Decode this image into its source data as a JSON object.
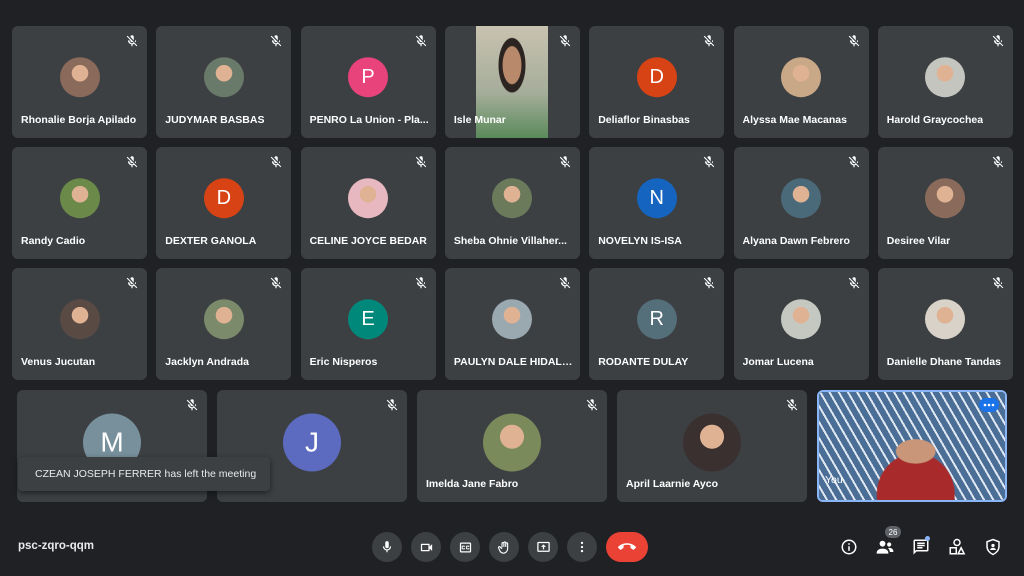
{
  "participants": [
    {
      "name": "Rhonalie Borja Apilado",
      "avatar": "photo",
      "color": "#8a6a5a"
    },
    {
      "name": "JUDYMAR BASBAS",
      "avatar": "photo",
      "color": "#6a7a6a"
    },
    {
      "name": "PENRO La Union - Pla...",
      "avatar": "letter",
      "letter": "P",
      "color": "#e8437a"
    },
    {
      "name": "Isle Munar",
      "avatar": "video",
      "color": "#a8b0a8"
    },
    {
      "name": "Deliaflor Binasbas",
      "avatar": "letter",
      "letter": "D",
      "color": "#d84315"
    },
    {
      "name": "Alyssa Mae Macanas",
      "avatar": "photo",
      "color": "#c9a888"
    },
    {
      "name": "Harold Graycochea",
      "avatar": "photo",
      "color": "#c5c5c0"
    },
    {
      "name": "Randy Cadio",
      "avatar": "photo",
      "color": "#6b8a4a"
    },
    {
      "name": "DEXTER GANOLA",
      "avatar": "letter",
      "letter": "D",
      "color": "#d84315"
    },
    {
      "name": "CELINE JOYCE BEDAR",
      "avatar": "photo",
      "color": "#e8b8c0"
    },
    {
      "name": "Sheba Ohnie Villaher...",
      "avatar": "photo",
      "color": "#6a7a5a"
    },
    {
      "name": "NOVELYN IS-ISA",
      "avatar": "letter",
      "letter": "N",
      "color": "#1565c0"
    },
    {
      "name": "Alyana Dawn Febrero",
      "avatar": "photo",
      "color": "#4a6a7a"
    },
    {
      "name": "Desiree Vilar",
      "avatar": "photo",
      "color": "#8a6a5a"
    },
    {
      "name": "Venus Jucutan",
      "avatar": "photo",
      "color": "#5a4a44"
    },
    {
      "name": "Jacklyn Andrada",
      "avatar": "photo",
      "color": "#7a8a6a"
    },
    {
      "name": "Eric Nisperos",
      "avatar": "letter",
      "letter": "E",
      "color": "#00897b"
    },
    {
      "name": "PAULYN DALE HIDALGO",
      "avatar": "photo",
      "color": "#9aa8b0"
    },
    {
      "name": "RODANTE DULAY",
      "avatar": "letter",
      "letter": "R",
      "color": "#546e7a"
    },
    {
      "name": "Jomar Lucena",
      "avatar": "photo",
      "color": "#c5c8c0"
    },
    {
      "name": "Danielle Dhane Tandas",
      "avatar": "photo",
      "color": "#d8d2c8"
    },
    {
      "name": "",
      "avatar": "letter",
      "letter": "M",
      "color": "#78909c"
    },
    {
      "name": "y Serna",
      "avatar": "letter",
      "letter": "J",
      "color": "#5c6bc0"
    },
    {
      "name": "Imelda Jane Fabro",
      "avatar": "photo",
      "color": "#7a8a5a"
    },
    {
      "name": "April Laarnie Ayco",
      "avatar": "photo",
      "color": "#3a3030"
    },
    {
      "name": "You",
      "avatar": "self-video",
      "color": "#2d3b4a"
    }
  ],
  "toast": {
    "text": "CZEAN JOSEPH FERRER has left the meeting"
  },
  "meeting": {
    "code": "psc-zqro-qqm"
  },
  "people_count": "26",
  "icons": {
    "mute": "mic-off-icon",
    "more": "more-options-icon",
    "controls": [
      "microphone-icon",
      "camera-icon",
      "captions-icon",
      "raise-hand-icon",
      "present-screen-icon",
      "more-vert-icon",
      "end-call-icon"
    ],
    "right": [
      "info-icon",
      "people-icon",
      "chat-icon",
      "activities-icon",
      "host-controls-icon"
    ]
  },
  "colors": {
    "background": "#202124",
    "tile": "#3c4043",
    "end_call": "#ea4335",
    "accent": "#8ab4f8"
  }
}
